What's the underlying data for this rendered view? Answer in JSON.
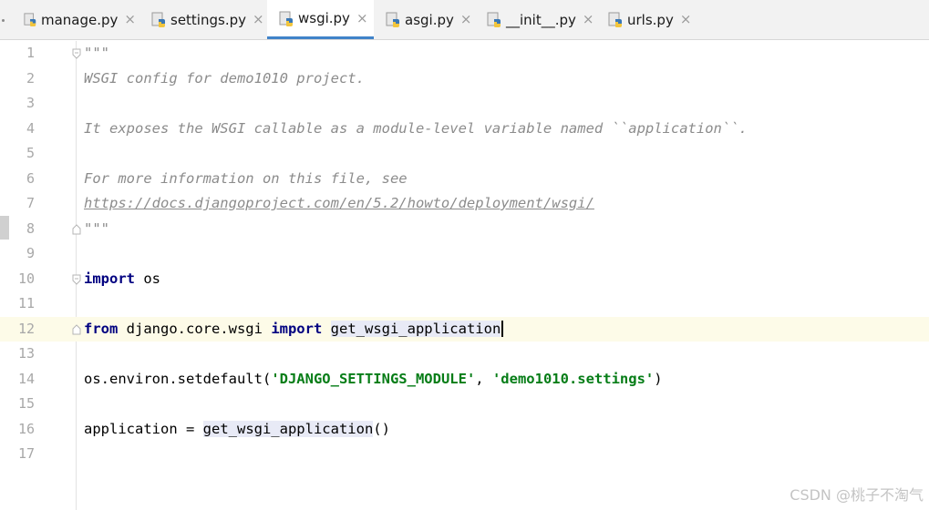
{
  "tabs": [
    {
      "label": "manage.py",
      "active": false
    },
    {
      "label": "settings.py",
      "active": false
    },
    {
      "label": "wsgi.py",
      "active": true
    },
    {
      "label": "asgi.py",
      "active": false
    },
    {
      "label": "__init__.py",
      "active": false
    },
    {
      "label": "urls.py",
      "active": false
    }
  ],
  "tab_close_glyph": "×",
  "accent_color": "#4083c9",
  "line_numbers": [
    "1",
    "2",
    "3",
    "4",
    "5",
    "6",
    "7",
    "8",
    "9",
    "10",
    "11",
    "12",
    "13",
    "14",
    "15",
    "16",
    "17"
  ],
  "code": {
    "l1": "\"\"\"",
    "l2": "WSGI config for demo1010 project.",
    "l4": "It exposes the WSGI callable as a module-level variable named ``application``.",
    "l6": "For more information on this file, see",
    "l7": "https://docs.djangoproject.com/en/5.2/howto/deployment/wsgi/",
    "l8": "\"\"\"",
    "l10_kw": "import",
    "l10_rest": " os",
    "l12_kw1": "from",
    "l12_mod": " django.core.wsgi ",
    "l12_kw2": "import",
    "l12_sp": " ",
    "l12_name": "get_wsgi_application",
    "l14_a": "os.environ.setdefault(",
    "l14_s1": "'DJANGO_SETTINGS_MODULE'",
    "l14_b": ", ",
    "l14_s2": "'demo1010.settings'",
    "l14_c": ")",
    "l16_a": "application = ",
    "l16_fn": "get_wsgi_application",
    "l16_b": "()"
  },
  "current_line": 12,
  "watermark": "CSDN @桃子不淘气"
}
